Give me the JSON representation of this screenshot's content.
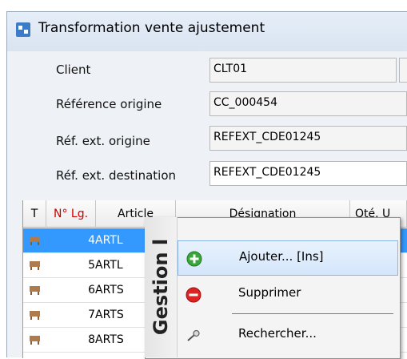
{
  "window": {
    "title": "Transformation vente ajustement"
  },
  "form": {
    "client": {
      "label": "Client",
      "value": "CLT01"
    },
    "ref_origine": {
      "label": "Référence origine",
      "value": "CC_000454"
    },
    "ref_ext_origine": {
      "label": "Réf. ext. origine",
      "value": "REFEXT_CDE01245"
    },
    "ref_ext_destination": {
      "label": "Réf. ext. destination",
      "value": "REFEXT_CDE01245"
    }
  },
  "grid": {
    "columns": [
      "T",
      "N° Lg.",
      "Article",
      "Désignation",
      "Qté. U"
    ],
    "rows": [
      {
        "num": "4",
        "article": "ARTL",
        "selected": true
      },
      {
        "num": "5",
        "article": "ARTL",
        "selected": false
      },
      {
        "num": "6",
        "article": "ARTS",
        "selected": false
      },
      {
        "num": "7",
        "article": "ARTS",
        "selected": false
      },
      {
        "num": "8",
        "article": "ARTS",
        "selected": false
      }
    ]
  },
  "context_menu": {
    "side_label": "Gestion l",
    "items": [
      {
        "label": "Ajouter... [Ins]",
        "icon": "add-icon",
        "highlighted": true
      },
      {
        "label": "Supprimer",
        "icon": "delete-icon",
        "highlighted": false
      },
      {
        "label": "Rechercher...",
        "icon": "search-icon",
        "highlighted": false
      }
    ]
  },
  "colors": {
    "selection": "#3399ff",
    "header_red": "#cc0000",
    "menu_highlight": "#d4e6fb"
  }
}
